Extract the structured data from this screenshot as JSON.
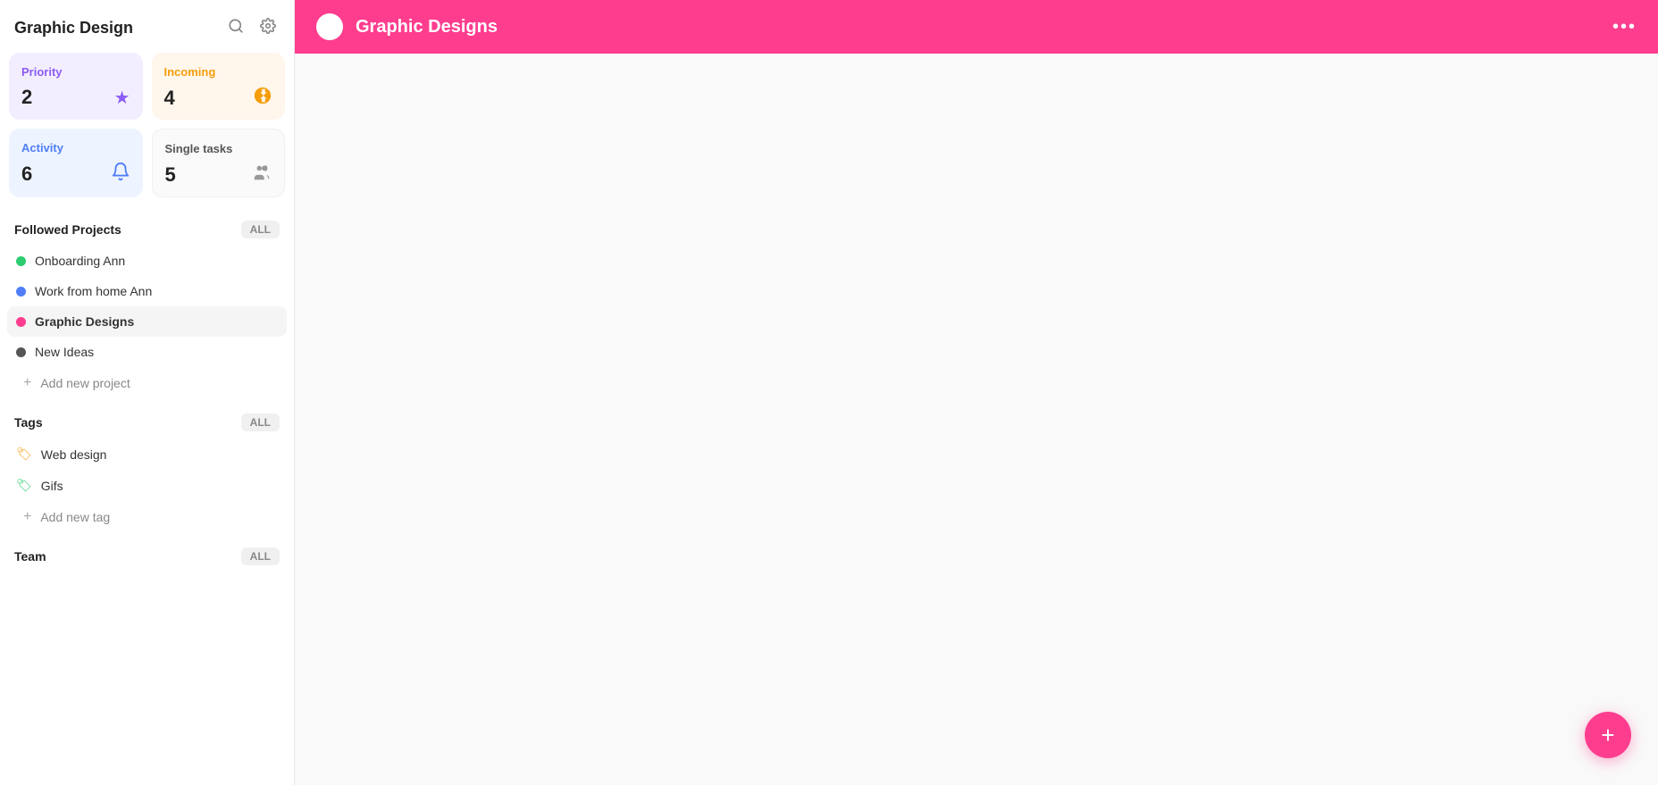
{
  "sidebar": {
    "title": "Graphic Design",
    "search_icon": "🔍",
    "settings_icon": "⚙",
    "stats": [
      {
        "key": "priority",
        "label": "Priority",
        "count": "2",
        "icon": "★",
        "card_class": "stat-card-priority"
      },
      {
        "key": "incoming",
        "label": "Incoming",
        "count": "4",
        "icon": "⬇",
        "card_class": "stat-card-incoming"
      },
      {
        "key": "activity",
        "label": "Activity",
        "count": "6",
        "icon": "🔔",
        "card_class": "stat-card-activity"
      },
      {
        "key": "single",
        "label": "Single tasks",
        "count": "5",
        "icon": "👥",
        "card_class": "stat-card-single"
      }
    ],
    "followed_projects": {
      "section_label": "Followed Projects",
      "all_label": "ALL",
      "items": [
        {
          "name": "Onboarding Ann",
          "color": "#2ecc71",
          "active": false
        },
        {
          "name": "Work from home Ann",
          "color": "#4f7ef7",
          "active": false
        },
        {
          "name": "Graphic Designs",
          "color": "#ff3d8e",
          "active": true
        },
        {
          "name": "New Ideas",
          "color": "#555",
          "active": false
        }
      ],
      "add_label": "Add new project"
    },
    "tags": {
      "section_label": "Tags",
      "all_label": "ALL",
      "items": [
        {
          "name": "Web design",
          "color": "#f59e0b"
        },
        {
          "name": "Gifs",
          "color": "#2ecc71"
        }
      ],
      "add_label": "Add new tag"
    },
    "team": {
      "section_label": "Team",
      "all_label": "ALL"
    }
  },
  "main": {
    "header": {
      "title": "Graphic Designs",
      "more_icon": "•••"
    },
    "fab_icon": "+"
  }
}
